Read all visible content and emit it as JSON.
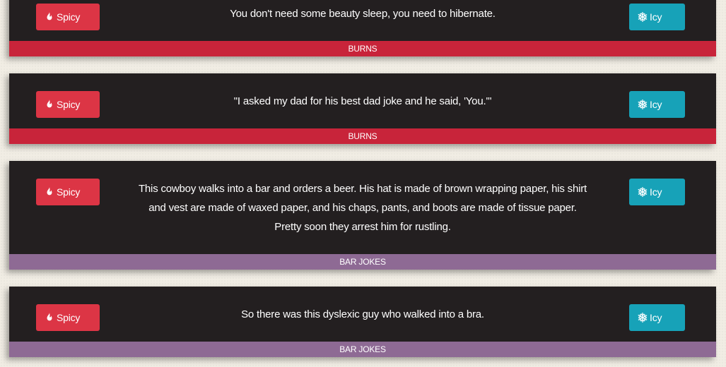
{
  "buttons": {
    "spicy_label": "Spicy",
    "icy_label": "Icy",
    "spicy_color": "#dc3545",
    "icy_color": "#17a2b8"
  },
  "jokes": [
    {
      "text": "You don't need some beauty sleep, you need to hibernate.",
      "category": "BURNS",
      "category_color": "#c8243a"
    },
    {
      "text": "\"I asked my dad for his best dad joke and he said, 'You.'\"",
      "category": "BURNS",
      "category_color": "#c8243a"
    },
    {
      "text": "This cowboy walks into a bar and orders a beer. His hat is made of brown wrapping paper, his shirt and vest are made of waxed paper, and his chaps, pants, and boots are made of tissue paper. Pretty soon they arrest him for rustling.",
      "category": "BAR JOKES",
      "category_color": "#8e6a94"
    },
    {
      "text": "So there was this dyslexic guy who walked into a bra.",
      "category": "BAR JOKES",
      "category_color": "#8e6a94"
    }
  ]
}
